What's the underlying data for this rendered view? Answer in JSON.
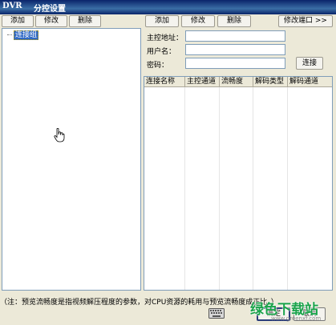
{
  "window": {
    "app": "DVR",
    "title": "分控设置"
  },
  "left_toolbar": {
    "add": "添加",
    "modify": "修改",
    "delete": "删除"
  },
  "tree": {
    "root_label": "连接组"
  },
  "right_toolbar": {
    "add": "添加",
    "modify": "修改",
    "delete": "删除",
    "modify_port": "修改端口 >>"
  },
  "form": {
    "host_label": "主控地址：",
    "host_value": "",
    "user_label": "用户名：",
    "user_value": "",
    "password_label": "密码：",
    "password_value": "",
    "connect": "连接"
  },
  "table": {
    "columns": [
      "连接名称",
      "主控通道",
      "流畅度",
      "解码类型",
      "解码通道"
    ],
    "rows": []
  },
  "footer": {
    "note": "（注：预览流畅度是指视频解压程度的参数，对CPU资源的耗用与预览流畅度成正比。）",
    "ok": "确定",
    "cancel": "取消"
  },
  "watermark": {
    "text": "绿色下载站",
    "url": "www.greenxf.com"
  },
  "colors": {
    "titlebar": "#0a246a",
    "tree_selection": "#316ac5",
    "watermark": "#1aa34a"
  }
}
